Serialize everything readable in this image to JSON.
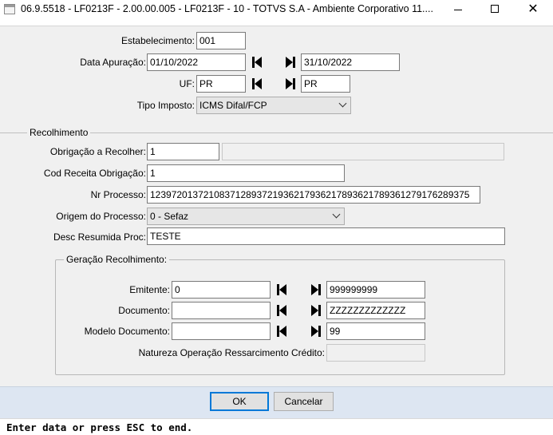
{
  "window": {
    "title": "06.9.5518 - LF0213F - 2.00.00.005 - LF0213F - 10 - TOTVS S.A - Ambiente Corporativo 11....",
    "icon": "app-window-icon",
    "minimize_icon": "minimize-icon",
    "maximize_icon": "maximize-icon",
    "close_icon": "close-icon",
    "close_glyph": "✕"
  },
  "header_form": {
    "estabelecimento": {
      "label": "Estabelecimento:",
      "value": "001"
    },
    "data_apuracao": {
      "label": "Data Apuração:",
      "from": "01/10/2022",
      "to": "31/10/2022"
    },
    "uf": {
      "label": "UF:",
      "from": "PR",
      "to": "PR"
    },
    "tipo_imposto": {
      "label": "Tipo Imposto:",
      "value": "ICMS Difal/FCP"
    }
  },
  "recolhimento": {
    "section_label": "Recolhimento",
    "obrigacao": {
      "label": "Obrigação a Recolher:",
      "value": "1",
      "description": ""
    },
    "cod_receita": {
      "label": "Cod Receita Obrigação:",
      "value": "1"
    },
    "nr_processo": {
      "label": "Nr Processo:",
      "value": "12397201372108371289372193621793621789362178936127917628937​5"
    },
    "origem_processo": {
      "label": "Origem do Processo:",
      "value": "0 - Sefaz"
    },
    "desc_resumida": {
      "label": "Desc Resumida Proc:",
      "value": "TESTE"
    }
  },
  "geracao": {
    "group_label": "Geração Recolhimento:",
    "emitente": {
      "label": "Emitente:",
      "from": "0",
      "to": "999999999"
    },
    "documento": {
      "label": "Documento:",
      "from": "",
      "to": "ZZZZZZZZZZZZZ"
    },
    "modelo_documento": {
      "label": "Modelo Documento:",
      "from": "",
      "to": "99"
    },
    "natureza": {
      "label": "Natureza Operação Ressarcimento Crédito:",
      "value": ""
    }
  },
  "buttons": {
    "ok": "OK",
    "cancel": "Cancelar"
  },
  "status": {
    "text": "Enter data or press ESC to end."
  },
  "icons": {
    "first": "first-record-icon",
    "last": "last-record-icon",
    "dropdown": "chevron-down-icon"
  },
  "colors": {
    "dialog_bg": "#f0f0f0",
    "button_bar_bg": "#dde6f2",
    "default_button_border": "#0078d7"
  }
}
